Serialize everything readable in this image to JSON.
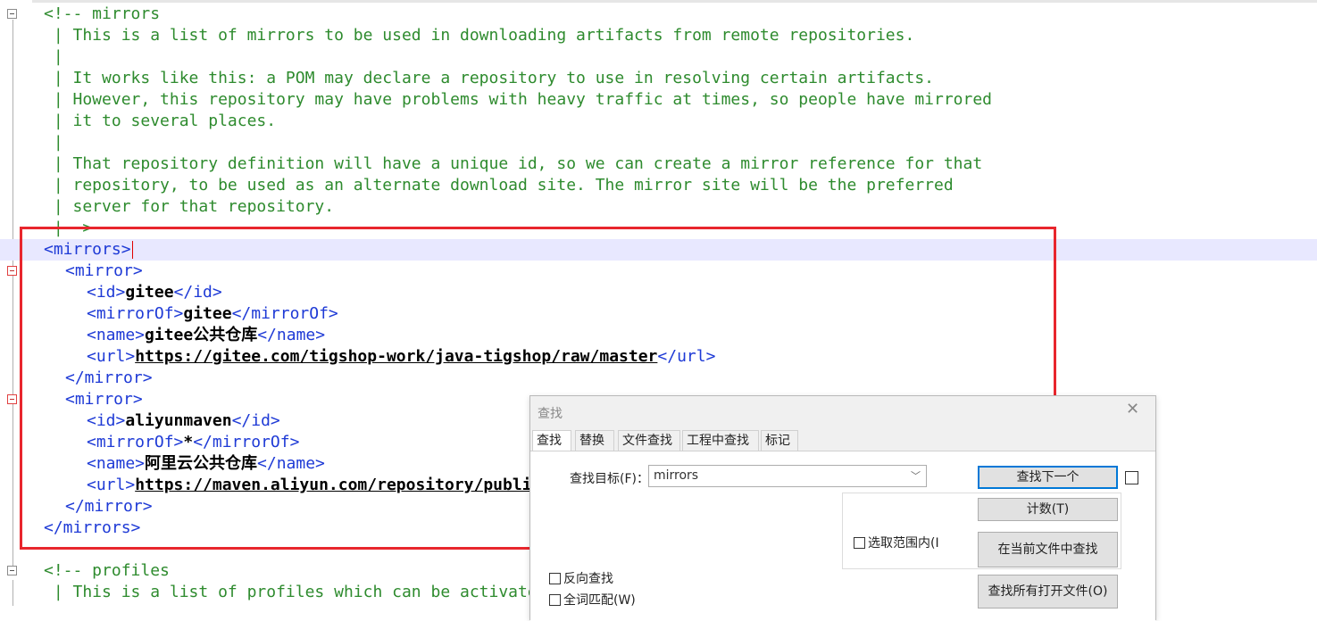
{
  "editor": {
    "lines": [
      {
        "type": "comment",
        "text": "<!-- mirrors"
      },
      {
        "type": "comment",
        "text": " | This is a list of mirrors to be used in downloading artifacts from remote repositories."
      },
      {
        "type": "comment",
        "text": " |"
      },
      {
        "type": "comment",
        "text": " | It works like this: a POM may declare a repository to use in resolving certain artifacts."
      },
      {
        "type": "comment",
        "text": " | However, this repository may have problems with heavy traffic at times, so people have mirrored"
      },
      {
        "type": "comment",
        "text": " | it to several places."
      },
      {
        "type": "comment",
        "text": " |"
      },
      {
        "type": "comment",
        "text": " | That repository definition will have a unique id, so we can create a mirror reference for that"
      },
      {
        "type": "comment",
        "text": " | repository, to be used as an alternate download site. The mirror site will be the preferred"
      },
      {
        "type": "comment",
        "text": " | server for that repository."
      },
      {
        "type": "comment",
        "text": " |-->"
      }
    ],
    "xml": {
      "mirrors_open": "<mirrors>",
      "mirror_open": "<mirror>",
      "mirror_close": "</mirror>",
      "mirrors_close": "</mirrors>",
      "id_open": "<id>",
      "id_close": "</id>",
      "mirrorof_open": "<mirrorOf>",
      "mirrorof_close": "</mirrorOf>",
      "name_open": "<name>",
      "name_close": "</name>",
      "url_open": "<url>",
      "url_close": "</url>",
      "m1": {
        "id": "gitee",
        "mirrorOf": "gitee",
        "name": "gitee公共仓库",
        "url": "https://gitee.com/tigshop-work/java-tigshop/raw/master"
      },
      "m2": {
        "id": "aliyunmaven",
        "mirrorOf": "*",
        "name": "阿里云公共仓库",
        "url": "https://maven.aliyun.com/repository/public"
      }
    },
    "profiles_lines": [
      {
        "type": "comment",
        "text": "<!-- profiles"
      },
      {
        "type": "comment",
        "text": " | This is a list of profiles which can be activated in a variety of ways, and which can modify"
      }
    ],
    "colors": {
      "comment": "#2e8b2e",
      "tag": "#1e3ad6",
      "current_line": "#e8e8ff",
      "highlight_box": "#e8262d"
    }
  },
  "find_dialog": {
    "title": "查找",
    "tabs": [
      "查找",
      "替换",
      "文件查找",
      "工程中查找",
      "标记"
    ],
    "active_tab": 0,
    "find_label": "查找目标(F)：",
    "find_value": "mirrors",
    "buttons": {
      "find_next": "查找下一个",
      "count": "计数(T)",
      "find_in_current": "在当前文件中查找",
      "find_in_all": "查找所有打开文件(O)"
    },
    "checkboxes": {
      "in_selection": "选取范围内(I",
      "reverse": "反向查找",
      "whole_word": "全词匹配(W)"
    },
    "icons": {
      "close": "close-icon",
      "dropdown": "chevron-down-icon"
    }
  }
}
